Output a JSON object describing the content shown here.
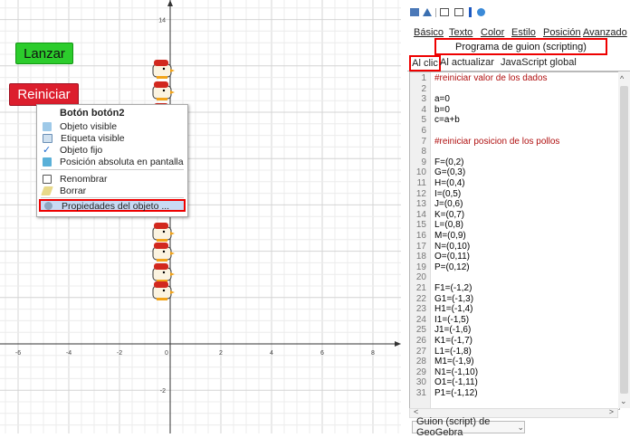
{
  "graphics": {
    "axis_x_ticks": [
      "-6",
      "-4",
      "-2",
      "0",
      "2",
      "4",
      "6",
      "8"
    ],
    "axis_y_ticks": [
      "14",
      "2",
      "-2",
      "-4"
    ]
  },
  "buttons": {
    "lanzar": "Lanzar",
    "reiniciar": "Reiniciar"
  },
  "context_menu": {
    "title": "Botón botón2",
    "items": [
      "Objeto visible",
      "Etiqueta visible",
      "Objeto fijo",
      "Posición absoluta en pantalla",
      "Renombrar",
      "Borrar",
      "Propiedades del objeto ..."
    ]
  },
  "panel": {
    "tabs": [
      "Básico",
      "Texto",
      "Color",
      "Estilo",
      "Posición",
      "Avanzado"
    ],
    "scripting_title": "Programa de guion (scripting)",
    "subtabs": [
      "Al clic",
      "Al actualizar",
      "JavaScript global"
    ],
    "code_lines": [
      "#reiniciar valor de los dados",
      "",
      "a=0",
      "b=0",
      "c=a+b",
      "",
      "#reiniciar posicion de los pollos",
      "",
      "F=(0,2)",
      "G=(0,3)",
      "H=(0,4)",
      "I=(0,5)",
      "J=(0,6)",
      "K=(0,7)",
      "L=(0,8)",
      "M=(0,9)",
      "N=(0,10)",
      "O=(0,11)",
      "P=(0,12)",
      "",
      "F1=(-1,2)",
      "G1=(-1,3)",
      "H1=(-1,4)",
      "I1=(-1,5)",
      "J1=(-1,6)",
      "K1=(-1,7)",
      "L1=(-1,8)",
      "M1=(-1,9)",
      "N1=(-1,10)",
      "O1=(-1,11)",
      "P1=(-1,12)"
    ],
    "script_language": "Guion (script) de GeoGebra"
  },
  "colors": {
    "lanzar_bg": "#2ccc2c",
    "reiniciar_bg": "#dc1e2d",
    "highlight_border": "#e00000",
    "menu_highlight": "#c8daf4"
  }
}
